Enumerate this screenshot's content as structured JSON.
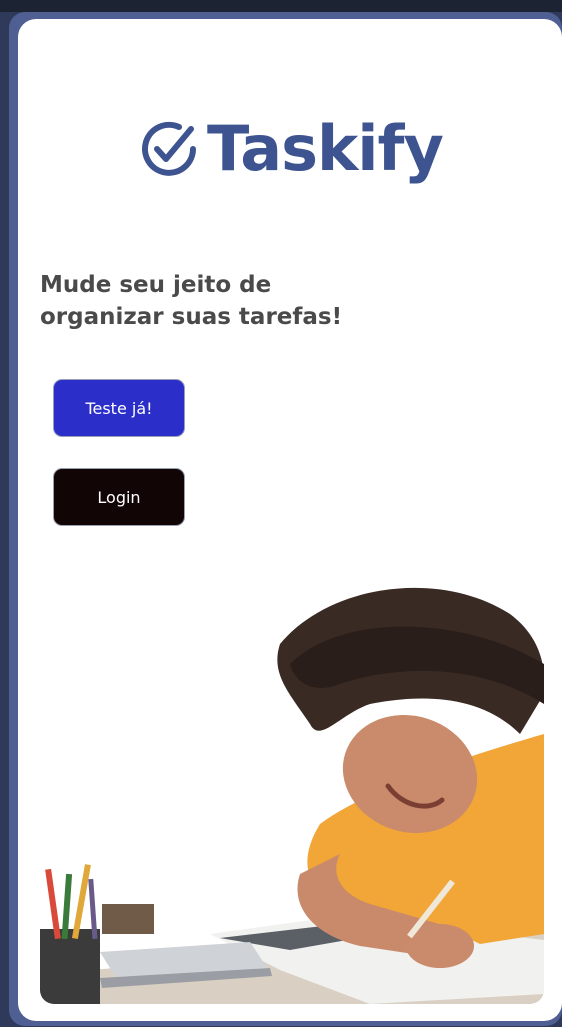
{
  "brand": {
    "name": "Taskify",
    "icon": "check-circle-icon",
    "color": "#3d5490"
  },
  "hero": {
    "headline_line1": "Mude seu jeito de",
    "headline_line2": "organizar suas tarefas!"
  },
  "buttons": {
    "try_label": "Teste já!",
    "login_label": "Login"
  },
  "colors": {
    "try_button": "#2b2ec9",
    "login_button": "#120506",
    "frame": "#4f5f93"
  },
  "image": {
    "subject": "student-studying-illustration"
  }
}
